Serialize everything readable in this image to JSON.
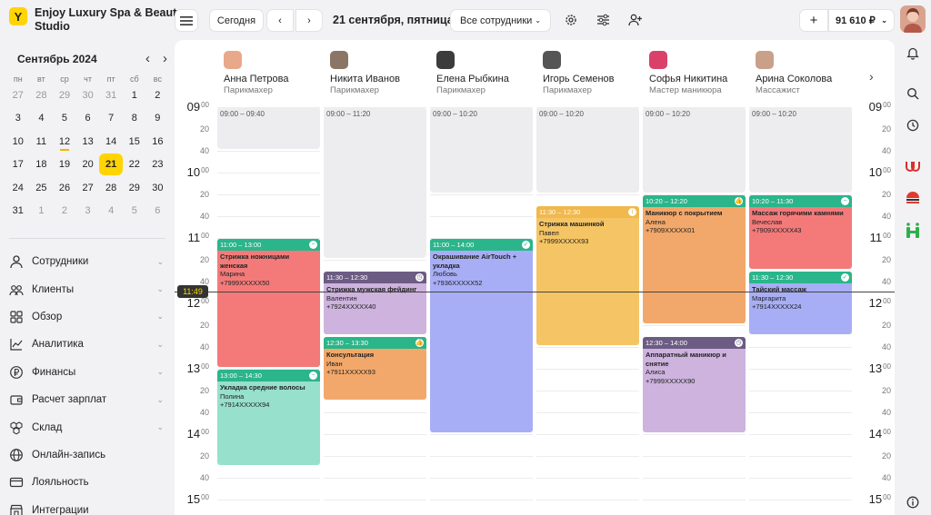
{
  "sidebar": {
    "brand": "Enjoy Luxury Spa & Beauty Studio",
    "logo": "Y",
    "month": "Сентябрь 2024",
    "weekdays": [
      "пн",
      "вт",
      "ср",
      "чт",
      "пт",
      "сб",
      "вс"
    ],
    "weeks": [
      [
        "27",
        "28",
        "29",
        "30",
        "31",
        "1",
        "2"
      ],
      [
        "3",
        "4",
        "5",
        "6",
        "7",
        "8",
        "9"
      ],
      [
        "10",
        "11",
        "12",
        "13",
        "14",
        "15",
        "16"
      ],
      [
        "17",
        "18",
        "19",
        "20",
        "21",
        "22",
        "23"
      ],
      [
        "24",
        "25",
        "26",
        "27",
        "28",
        "29",
        "30"
      ],
      [
        "31",
        "1",
        "2",
        "3",
        "4",
        "5",
        "6"
      ]
    ],
    "menu": [
      {
        "label": "Сотрудники",
        "icon": "user-icon"
      },
      {
        "label": "Клиенты",
        "icon": "users-icon"
      },
      {
        "label": "Обзор",
        "icon": "grid-icon"
      },
      {
        "label": "Аналитика",
        "icon": "chart-icon"
      },
      {
        "label": "Финансы",
        "icon": "ruble-icon"
      },
      {
        "label": "Расчет зарплат",
        "icon": "wallet-icon"
      },
      {
        "label": "Склад",
        "icon": "boxes-icon"
      },
      {
        "label": "Онлайн-запись",
        "icon": "globe-icon"
      },
      {
        "label": "Лояльность",
        "icon": "card-icon"
      },
      {
        "label": "Интеграции",
        "icon": "store-icon"
      }
    ]
  },
  "topbar": {
    "today": "Сегодня",
    "date_title": "21 сентября, пятница",
    "staff_filter": "Все сотрудники",
    "balance": "91 610 ₽"
  },
  "now_time": "11:49",
  "times": [
    {
      "h": "09",
      "m": "00"
    },
    {
      "m": "20"
    },
    {
      "m": "40"
    },
    {
      "h": "10",
      "m": "00"
    },
    {
      "m": "20"
    },
    {
      "m": "40"
    },
    {
      "h": "11",
      "m": "00"
    },
    {
      "m": "20"
    },
    {
      "m": "40"
    },
    {
      "h": "12",
      "m": "00"
    },
    {
      "m": "20"
    },
    {
      "m": "40"
    },
    {
      "h": "13",
      "m": "00"
    },
    {
      "m": "20"
    },
    {
      "m": "40"
    },
    {
      "h": "14",
      "m": "00"
    },
    {
      "m": "20"
    },
    {
      "m": "40"
    },
    {
      "h": "15",
      "m": "00"
    }
  ],
  "staff": [
    {
      "name": "Анна Петрова",
      "role": "Парикмахер",
      "avatar": "#e8a88a",
      "busy": "09:00 – 09:40"
    },
    {
      "name": "Никита Иванов",
      "role": "Парикмахер",
      "avatar": "#8a7566",
      "busy": "09:00 – 11:20"
    },
    {
      "name": "Елена Рыбкина",
      "role": "Парикмахер",
      "avatar": "#3c3c3c",
      "busy": "09:00 – 10:20"
    },
    {
      "name": "Игорь Семенов",
      "role": "Парикмахер",
      "avatar": "#555555",
      "busy": "09:00 – 10:20"
    },
    {
      "name": "Софья Никитина",
      "role": "Мастер маникюра",
      "avatar": "#d9406a",
      "busy": "09:00 – 10:20"
    },
    {
      "name": "Арина Соколова",
      "role": "Массажист",
      "avatar": "#c9a089",
      "busy": "09:00 – 10:20"
    }
  ],
  "appointments": [
    {
      "col": 0,
      "start": "11:00",
      "end": "13:00",
      "time": "11:00 – 13:00",
      "service": "Стрижка ножницами женская",
      "client": "Марина",
      "phone": "+7999XXXXX50",
      "head": "#2bb58a",
      "body": "#f47a7a",
      "status": "minus"
    },
    {
      "col": 0,
      "start": "13:00",
      "end": "14:30",
      "time": "13:00 – 14:30",
      "service": "Укладка средние волосы",
      "client": "Полина",
      "phone": "+7914XXXXX94",
      "head": "#2bb58a",
      "body": "#97e0cc",
      "status": "minus"
    },
    {
      "col": 1,
      "start": "11:30",
      "end": "12:30",
      "time": "11:30 – 12:30",
      "service": "Стрижка мужская фейдинг",
      "client": "Валентин",
      "phone": "+7924XXXXX40",
      "head": "#6c5c83",
      "body": "#cdb3de",
      "status": "clock"
    },
    {
      "col": 1,
      "start": "12:30",
      "end": "13:30",
      "time": "12:30 – 13:30",
      "service": "Консультация",
      "client": "Иван",
      "phone": "+7911XXXXX93",
      "head": "#2bb58a",
      "body": "#f2a86a",
      "status": "like"
    },
    {
      "col": 2,
      "start": "11:00",
      "end": "14:00",
      "time": "11:00 – 14:00",
      "service": "Окрашивание AirTouch + укладка",
      "client": "Любовь",
      "phone": "+7936XXXXX52",
      "head": "#2bb58a",
      "body": "#a8aef5",
      "status": "check"
    },
    {
      "col": 3,
      "start": "10:30",
      "end": "12:40",
      "time": "11:30 – 12:30",
      "service": "Стрижка машинкой",
      "client": "Павел",
      "phone": "+7999XXXXX93",
      "head": "#f0b84d",
      "body": "#f5c565",
      "status": "info"
    },
    {
      "col": 4,
      "start": "10:20",
      "end": "12:20",
      "time": "10:20 – 12:20",
      "service": "Маникюр с покрытием",
      "client": "Алена",
      "phone": "+7909XXXXX01",
      "head": "#2bb58a",
      "body": "#f2a86a",
      "status": "like"
    },
    {
      "col": 4,
      "start": "12:30",
      "end": "14:00",
      "time": "12:30 – 14:00",
      "service": "Аппаратный маникюр и снятие",
      "client": "Алиса",
      "phone": "+7999XXXXX90",
      "head": "#6c5c83",
      "body": "#cdb3de",
      "status": "clock"
    },
    {
      "col": 5,
      "start": "10:20",
      "end": "11:30",
      "time": "10:20 – 11:30",
      "service": "Массаж горячими камнями",
      "client": "Вечеслав",
      "phone": "+7909XXXXX43",
      "head": "#2bb58a",
      "body": "#f47a7a",
      "status": "minus"
    },
    {
      "col": 5,
      "start": "11:30",
      "end": "12:30",
      "time": "11:30 – 12:30",
      "service": "Тайский массаж",
      "client": "Маргарита",
      "phone": "+7914XXXXX24",
      "head": "#2bb58a",
      "body": "#a8aef5",
      "status": "check"
    }
  ]
}
